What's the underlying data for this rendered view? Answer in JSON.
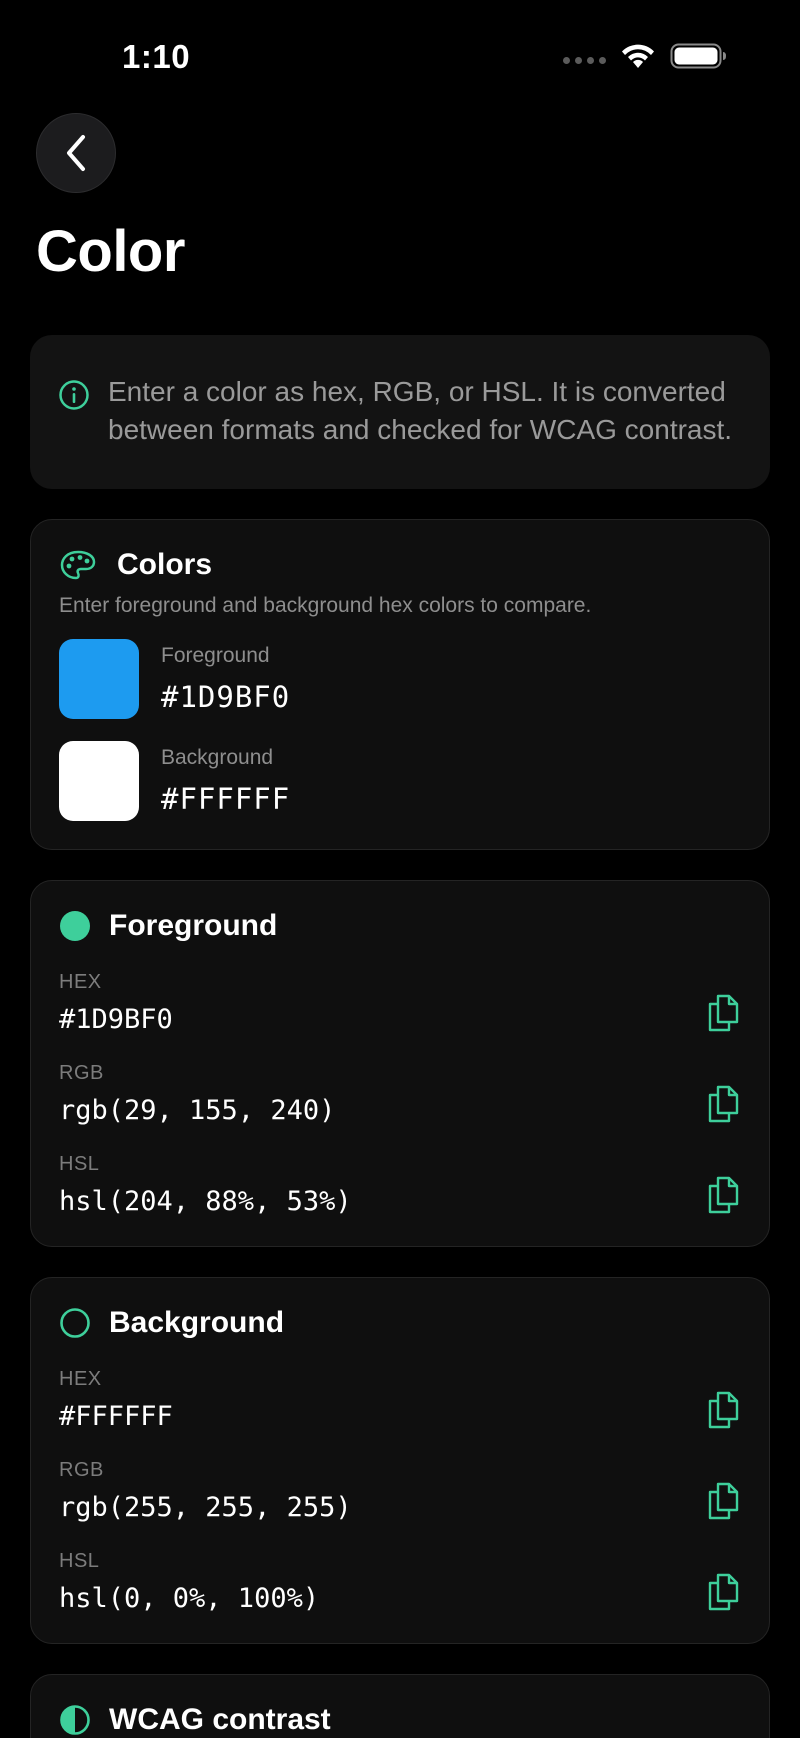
{
  "status": {
    "time": "1:10"
  },
  "page": {
    "title": "Color"
  },
  "info": {
    "text": "Enter a color as hex, RGB, or HSL. It is converted between formats and checked for WCAG contrast."
  },
  "colors_card": {
    "title": "Colors",
    "subtitle": "Enter foreground and background hex colors to compare.",
    "foreground": {
      "label": "Foreground",
      "value": "#1D9BF0",
      "swatch": "#1D9BF0"
    },
    "background": {
      "label": "Background",
      "value": "#FFFFFF",
      "swatch": "#FFFFFF"
    }
  },
  "foreground_card": {
    "title": "Foreground",
    "rows": [
      {
        "label": "HEX",
        "value": "#1D9BF0"
      },
      {
        "label": "RGB",
        "value": "rgb(29, 155, 240)"
      },
      {
        "label": "HSL",
        "value": "hsl(204, 88%, 53%)"
      }
    ]
  },
  "background_card": {
    "title": "Background",
    "rows": [
      {
        "label": "HEX",
        "value": "#FFFFFF"
      },
      {
        "label": "RGB",
        "value": "rgb(255, 255, 255)"
      },
      {
        "label": "HSL",
        "value": "hsl(0, 0%, 100%)"
      }
    ]
  },
  "wcag_card": {
    "title": "WCAG contrast"
  },
  "theme": {
    "accent": "#3ecf9b",
    "background": "#000000",
    "card": "#0f0f0f"
  }
}
